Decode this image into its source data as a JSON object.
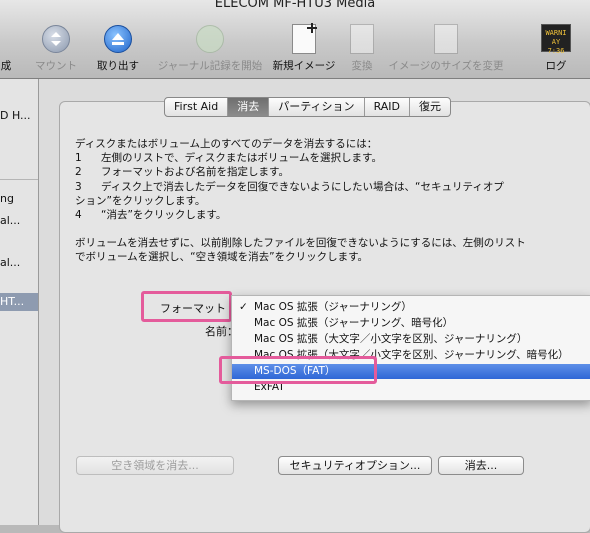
{
  "window": {
    "title": "ELECOM MF-HTU3 Media"
  },
  "toolbar": {
    "items": [
      {
        "label": "成",
        "icon": "partial-icon",
        "enabled": true
      },
      {
        "label": "マウント",
        "icon": "mount-icon",
        "enabled": false
      },
      {
        "label": "取り出す",
        "icon": "eject-icon",
        "enabled": true
      },
      {
        "label": "ジャーナル記録を開始",
        "icon": "journaling-icon",
        "enabled": false
      },
      {
        "label": "新規イメージ",
        "icon": "new-image-icon",
        "enabled": true
      },
      {
        "label": "変換",
        "icon": "convert-icon",
        "enabled": false
      },
      {
        "label": "イメージのサイズを変更",
        "icon": "resize-image-icon",
        "enabled": false
      },
      {
        "label": "ログ",
        "icon": "log-icon",
        "enabled": true
      }
    ],
    "log_icon_text": [
      "WARNI",
      "AY 7:36"
    ]
  },
  "sidebar": {
    "items": [
      {
        "label": "D H..."
      },
      {
        "label": "ng"
      },
      {
        "label": "al..."
      },
      {
        "label": "al..."
      },
      {
        "label": "HT...",
        "selected": true
      }
    ]
  },
  "tabs": [
    {
      "label": "First Aid",
      "active": false
    },
    {
      "label": "消去",
      "active": true
    },
    {
      "label": "パーティション",
      "active": false
    },
    {
      "label": "RAID",
      "active": false
    },
    {
      "label": "復元",
      "active": false
    }
  ],
  "instructions": {
    "intro": "ディスクまたはボリューム上のすべてのデータを消去するには：",
    "steps": [
      {
        "num": "1",
        "text": "左側のリストで、ディスクまたはボリュームを選択します。"
      },
      {
        "num": "2",
        "text": "フォーマットおよび名前を指定します。"
      },
      {
        "num": "3",
        "text": "ディスク上で消去したデータを回復できないようにしたい場合は、“セキュリティオプション”をクリックします。",
        "line1": "ディスク上で消去したデータを回復できないようにしたい場合は、“セキュリティオプ",
        "line2": "ション”をクリックします。"
      },
      {
        "num": "4",
        "text": "“消去”をクリックします。"
      }
    ],
    "note_line1": "ボリュームを消去せずに、以前削除したファイルを回復できないようにするには、左側のリスト",
    "note_line2": "でボリュームを選択し、“空き領域を消去”をクリックします。"
  },
  "form": {
    "format_label": "フォーマット",
    "name_label": "名前："
  },
  "format_menu": {
    "options": [
      {
        "label": "Mac OS 拡張（ジャーナリング）",
        "checked": true,
        "selected": false
      },
      {
        "label": "Mac OS 拡張（ジャーナリング、暗号化）",
        "checked": false,
        "selected": false
      },
      {
        "label": "Mac OS 拡張（大文字／小文字を区別、ジャーナリング）",
        "checked": false,
        "selected": false
      },
      {
        "label": "Mac OS 拡張（大文字／小文字を区別、ジャーナリング、暗号化）",
        "checked": false,
        "selected": false
      },
      {
        "label": "MS-DOS（FAT）",
        "checked": false,
        "selected": true
      },
      {
        "label": "ExFAT",
        "checked": false,
        "selected": false
      }
    ],
    "check_mark": "✓"
  },
  "buttons": {
    "erase_free_space": "空き領域を消去...",
    "security_options": "セキュリティオプション...",
    "erase": "消去..."
  },
  "colors": {
    "highlight": "#e45b9b",
    "selection": "#2f67d6"
  }
}
